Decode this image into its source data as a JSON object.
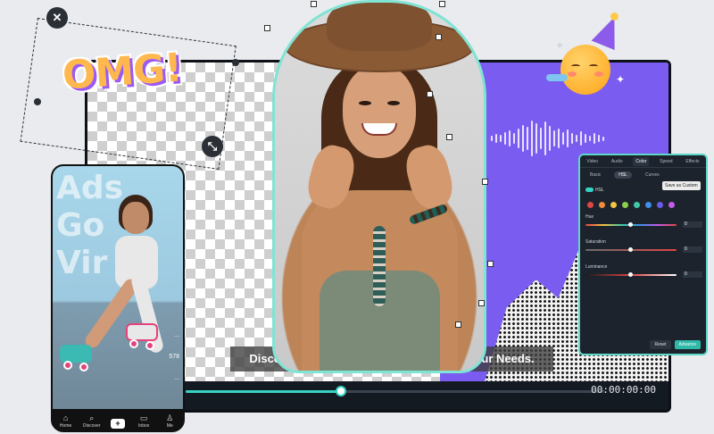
{
  "editor": {
    "caption": "Discover the Perfect Video Solution for Your Needs.",
    "timecode": "00:00:00:00",
    "playback_progress": 0.37,
    "zoom_level": 0.5,
    "accent_color": "#36d3c2",
    "bg_purple": "#7b5cf0"
  },
  "sticker": {
    "text": "OMG!"
  },
  "phone": {
    "overlay_lines": [
      "Ads",
      "Go",
      "Vir"
    ],
    "side_counts": [
      "...",
      "578",
      "..."
    ],
    "nav": [
      {
        "label": "Home",
        "icon": "home-icon",
        "glyph": "⌂"
      },
      {
        "label": "Discover",
        "icon": "search-icon",
        "glyph": "⌕"
      },
      {
        "label": "",
        "icon": "plus-icon",
        "glyph": "+"
      },
      {
        "label": "Inbox",
        "icon": "inbox-icon",
        "glyph": "▭"
      },
      {
        "label": "Me",
        "icon": "profile-icon",
        "glyph": "♙"
      }
    ]
  },
  "color_panel": {
    "tabs": [
      "Video",
      "Audio",
      "Color",
      "Speed",
      "Effects"
    ],
    "active_tab": "Color",
    "subtabs": [
      "Basic",
      "HSL",
      "Curves"
    ],
    "active_subtab": "HSL",
    "tooltip": "Save as Custom",
    "hsl_label": "HSL",
    "swatch_colors": [
      "#e04545",
      "#f08a3c",
      "#f2c640",
      "#8ccf4a",
      "#3fc9a6",
      "#3f8ee8",
      "#6a5ce8",
      "#c45ce8"
    ],
    "rows": [
      {
        "label": "Hue",
        "value": "0"
      },
      {
        "label": "Saturation",
        "value": "0"
      },
      {
        "label": "Luminance",
        "value": "0"
      }
    ],
    "reset_label": "Reset",
    "advanced_label": "Advance"
  }
}
